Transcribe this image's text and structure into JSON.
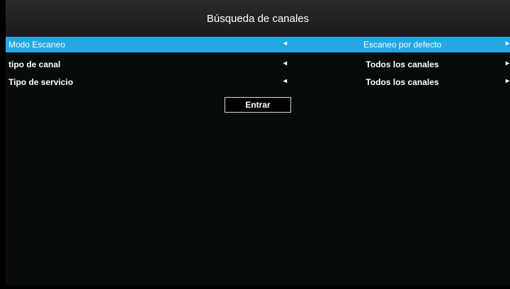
{
  "header": {
    "title": "Búsqueda de canales"
  },
  "settings": [
    {
      "label": "Modo Escaneo",
      "value": "Escaneo por defecto",
      "selected": true
    },
    {
      "label": "tipo de canal",
      "value": "Todos los canales",
      "selected": false
    },
    {
      "label": "Tipo de servicio",
      "value": "Todos los canales",
      "selected": false
    }
  ],
  "dialog": {
    "enter_label": "Entrar"
  },
  "icons": {
    "left_arrow": "arrow-left-icon",
    "right_arrow": "arrow-right-icon"
  },
  "colors": {
    "selected_row": "#25a7e2",
    "background": "#000000",
    "title_bar": "#222222"
  }
}
